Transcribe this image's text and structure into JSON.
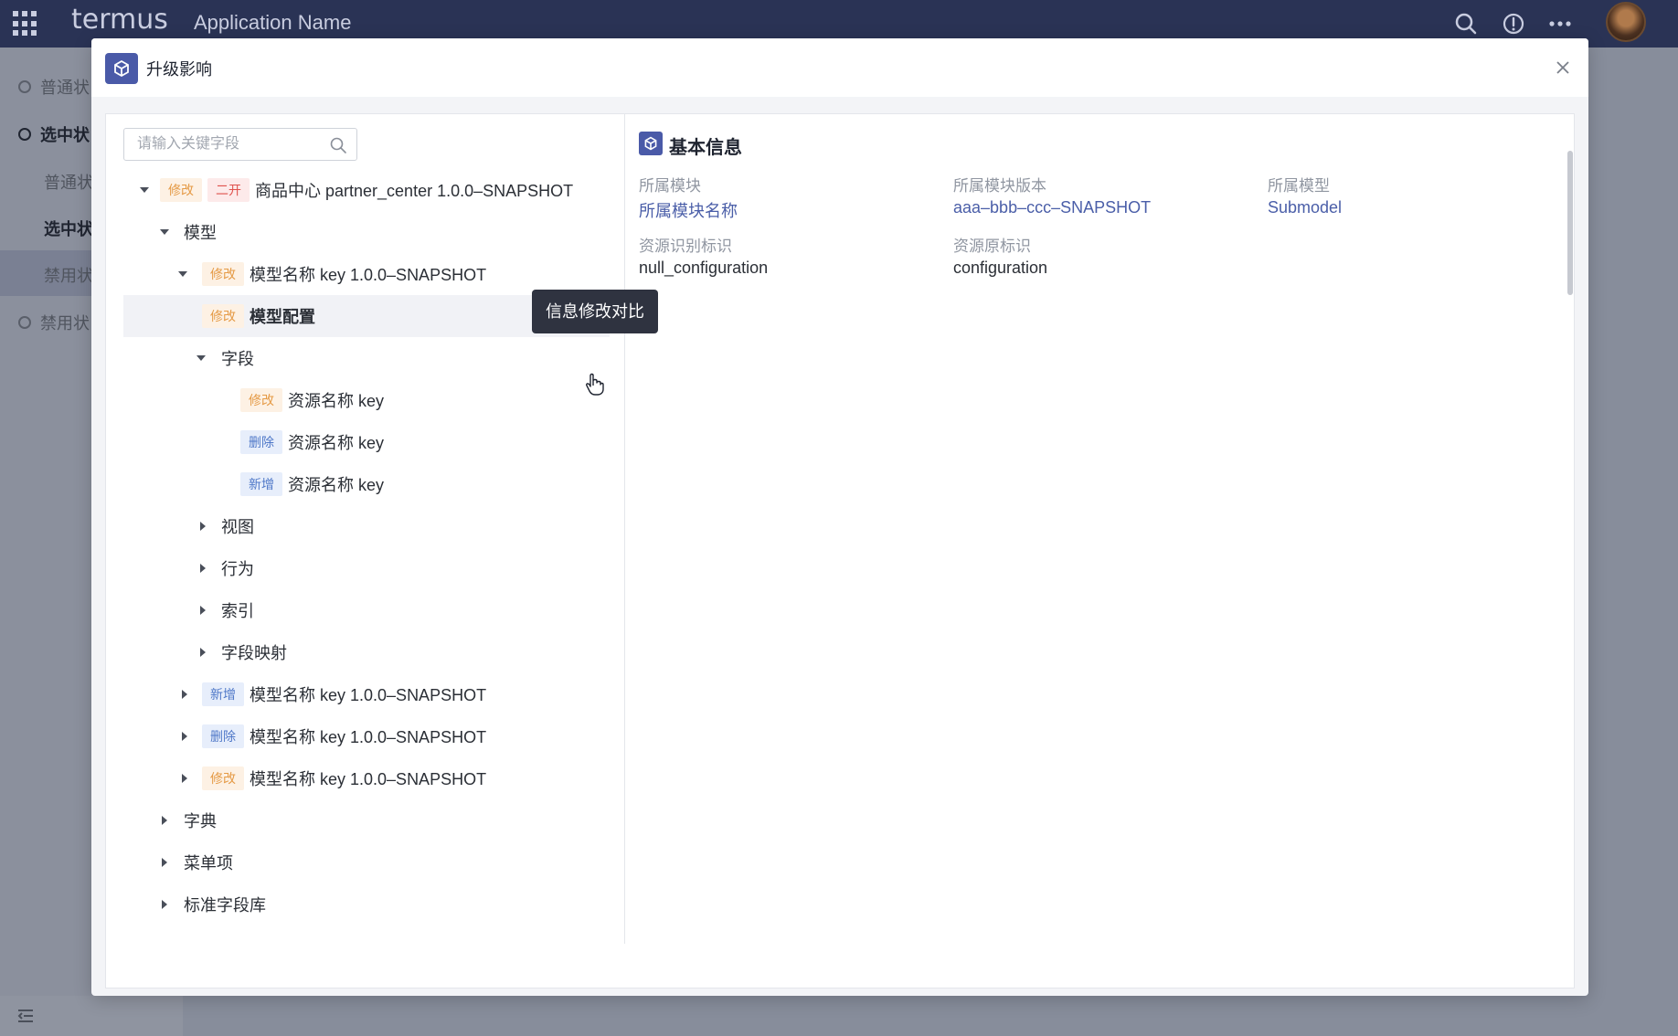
{
  "app": {
    "logo_text": "termus",
    "name": "Application Name",
    "brand_color": "#2a3355"
  },
  "topbar_icons": [
    "search-icon",
    "info-icon",
    "more-icon",
    "user-avatar"
  ],
  "bg_sidebar": {
    "items": [
      {
        "label": "普通状"
      },
      {
        "label": "选中状"
      },
      {
        "label": "普通状"
      },
      {
        "label": "选中状"
      },
      {
        "label": "禁用状"
      },
      {
        "label": "禁用状"
      }
    ]
  },
  "modal": {
    "title": "升级影响",
    "search": {
      "placeholder": "请输入关键字段"
    },
    "tree": {
      "tags": {
        "mod": "修改",
        "two": "二开",
        "del": "删除",
        "add": "新增"
      },
      "root": "商品中心 partner_center 1.0.0–SNAPSHOT",
      "model_group": "模型",
      "model1": "模型名称 key 1.0.0–SNAPSHOT",
      "model_config": "模型配置",
      "fields": "字段",
      "field1": "资源名称 key",
      "field2": "资源名称 key",
      "field3": "资源名称 key",
      "view": "视图",
      "behavior": "行为",
      "index": "索引",
      "field_map": "字段映射",
      "model2": "模型名称 key 1.0.0–SNAPSHOT",
      "model3": "模型名称 key 1.0.0–SNAPSHOT",
      "model4": "模型名称 key 1.0.0–SNAPSHOT",
      "dict": "字典",
      "menu": "菜单项",
      "std_fields": "标准字段库"
    },
    "tooltip": "信息修改对比",
    "info": {
      "title": "基本信息",
      "module_label": "所属模块",
      "module_value": "所属模块名称",
      "module_version_label": "所属模块版本",
      "module_version_value": "aaa–bbb–ccc–SNAPSHOT",
      "model_label": "所属模型",
      "model_value": "Submodel",
      "resource_id_label": "资源识别标识",
      "resource_id_value": "null_configuration",
      "resource_orig_label": "资源原标识",
      "resource_orig_value": "configuration"
    }
  }
}
